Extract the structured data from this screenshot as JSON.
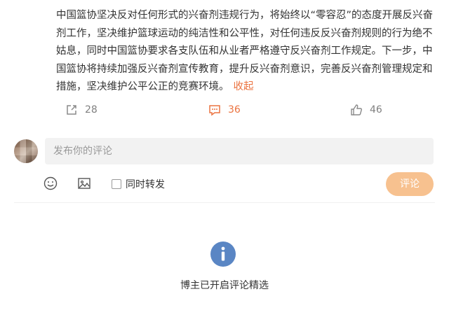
{
  "post": {
    "text": "中国篮协坚决反对任何形式的兴奋剂违规行为，将始终以“零容忍”的态度开展反兴奋剂工作，坚决维护篮球运动的纯洁性和公平性，对任何违反反兴奋剂规则的行为绝不姑息，同时中国篮协要求各支队伍和从业者严格遵守反兴奋剂工作规定。下一步，中国篮协将持续加强反兴奋剂宣传教育，提升反兴奋剂意识，完善反兴奋剂管理规定和措施，坚决维护公平公正的竞赛环境。",
    "collapse_label": "收起"
  },
  "actions": {
    "forward_count": "28",
    "comment_count": "36",
    "like_count": "46"
  },
  "comment_box": {
    "placeholder": "发布你的评论",
    "repost_label": "同时转发",
    "submit_label": "评论"
  },
  "notice": {
    "text": "博主已开启评论精选"
  },
  "colors": {
    "accent": "#eb7340",
    "submit_bg": "#f7c18f",
    "info_icon": "#5a86c4"
  }
}
